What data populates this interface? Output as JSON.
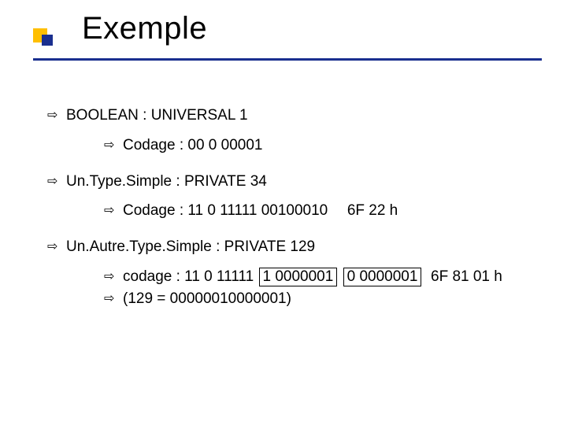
{
  "title": "Exemple",
  "items": [
    {
      "label": "BOOLEAN : UNIVERSAL 1",
      "children": [
        {
          "label": "Codage : 00 0 00001"
        }
      ]
    },
    {
      "label": "Un.Type.Simple : PRIVATE 34",
      "children": [
        {
          "label_pre": "Codage : 11 0 11111 00100010",
          "label_post": "6F 22 h"
        }
      ]
    },
    {
      "label": "Un.Autre.Type.Simple : PRIVATE 129",
      "children": [
        {
          "label_pre": "codage : 11 0 11111",
          "box1": "1 0000001",
          "box2": "0 0000001",
          "label_post": "6F 81 01 h"
        },
        {
          "label": "(129 = 00000010000001)"
        }
      ]
    }
  ],
  "arrow_glyph": "⇨"
}
